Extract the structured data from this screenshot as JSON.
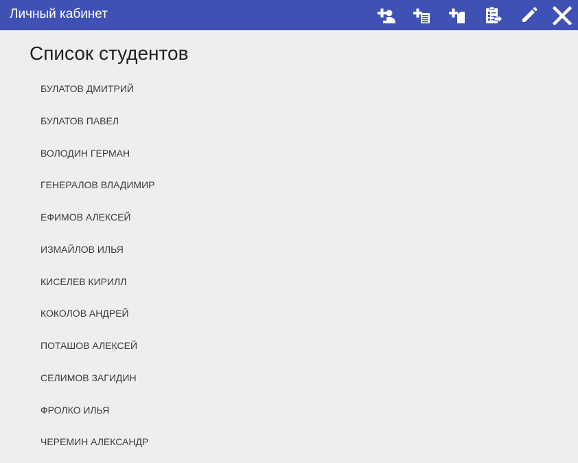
{
  "header": {
    "title": "Личный кабинет",
    "background": "#3f51b5",
    "icons": [
      {
        "name": "add-user-icon"
      },
      {
        "name": "add-document-icon"
      },
      {
        "name": "add-file-icon"
      },
      {
        "name": "assignment-export-icon"
      },
      {
        "name": "edit-pencil-icon"
      },
      {
        "name": "close-icon"
      }
    ]
  },
  "main": {
    "title": "Список студентов",
    "students": [
      "БУЛАТОВ ДМИТРИЙ",
      "БУЛАТОВ ПАВЕЛ",
      "ВОЛОДИН ГЕРМАН",
      "ГЕНЕРАЛОВ ВЛАДИМИР",
      "ЕФИМОВ АЛЕКСЕЙ",
      "ИЗМАЙЛОВ ИЛЬЯ",
      "КИСЕЛЕВ КИРИЛЛ",
      "КОКОЛОВ АНДРЕЙ",
      "ПОТАШОВ АЛЕКСЕЙ",
      "СЕЛИМОВ ЗАГИДИН",
      "ФРОЛКО ИЛЬЯ",
      "ЧЕРЕМИН АЛЕКСАНДР"
    ]
  }
}
